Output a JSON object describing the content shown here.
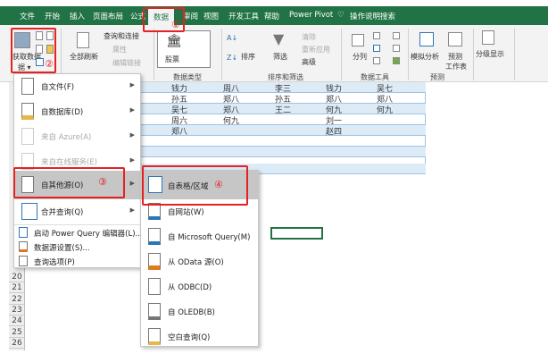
{
  "tabs": [
    "文件",
    "开始",
    "插入",
    "页面布局",
    "公式",
    "数据",
    "审阅",
    "视图",
    "开发工具",
    "帮助",
    "Power Pivot",
    "操作说明搜索"
  ],
  "ribbon": {
    "get_data": "获取数据",
    "get_data2": "据 ▾",
    "refresh_all": "全部刷新",
    "queries": "查询和连接",
    "properties": "属性",
    "edit_links": "编辑链接",
    "stocks": "股票",
    "sort": "排序",
    "filter": "筛选",
    "clear": "清除",
    "reapply": "重新应用",
    "advanced": "高级",
    "split": "分列",
    "whatif": "模拟分析",
    "forecast": "预测",
    "forecast2": "工作表",
    "outline": "分级显示",
    "groups": [
      "数据类型",
      "排序和筛选",
      "数据工具",
      "预测"
    ]
  },
  "annotations": [
    "①",
    "②",
    "③",
    "④"
  ],
  "table": {
    "rows": [
      [
        "钱力",
        "周八",
        "李三",
        "钱力",
        "吴七"
      ],
      [
        "孙五",
        "郑八",
        "孙五",
        "郑八",
        "郑八"
      ],
      [
        "吴七",
        "郑八",
        "王二",
        "何九",
        "何九"
      ],
      [
        "周六",
        "何九",
        "",
        "刘一",
        ""
      ],
      [
        "郑八",
        "",
        "",
        "赵四",
        ""
      ]
    ]
  },
  "row_numbers": [
    "20",
    "21",
    "22",
    "23",
    "24",
    "25",
    "26"
  ],
  "menu": {
    "items": [
      "自文件(F)",
      "自数据库(D)",
      "来自 Azure(A)",
      "来自在线服务(E)",
      "自其他源(O)",
      "合并查询(Q)",
      "启动 Power Query 编辑器(L)...",
      "数据源设置(S)...",
      "查询选项(P)"
    ]
  },
  "submenu": {
    "items": [
      "自表格/区域",
      "自网站(W)",
      "自 Microsoft Query(M)",
      "从 OData 源(O)",
      "从 ODBC(D)",
      "自 OLEDB(B)",
      "空白查询(Q)"
    ]
  },
  "colors": {
    "excel_green": "#217346",
    "highlight": "#c6c6c6",
    "annotation": "#e52222",
    "table_band": "#ddebf7"
  }
}
